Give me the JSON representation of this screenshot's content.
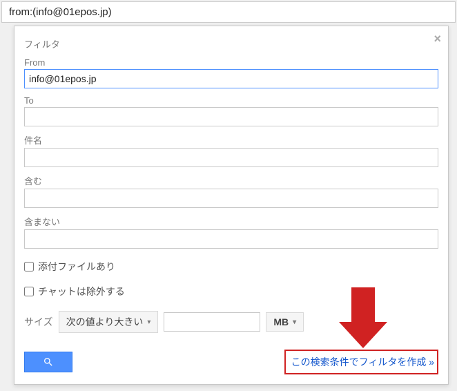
{
  "search_bar": {
    "value": "from:(info@01epos.jp)"
  },
  "panel": {
    "title": "フィルタ",
    "labels": {
      "from": "From",
      "to": "To",
      "subject": "件名",
      "has": "含む",
      "not_has": "含まない",
      "attachment": "添付ファイルあり",
      "exclude_chat": "チャットは除外する",
      "size": "サイズ"
    },
    "values": {
      "from": "info@01epos.jp",
      "to": "",
      "subject": "",
      "has": "",
      "not_has": ""
    },
    "size_operator": "次の値より大きい",
    "size_unit": "MB",
    "create_filter_text": "この検索条件でフィルタを作成 »"
  }
}
